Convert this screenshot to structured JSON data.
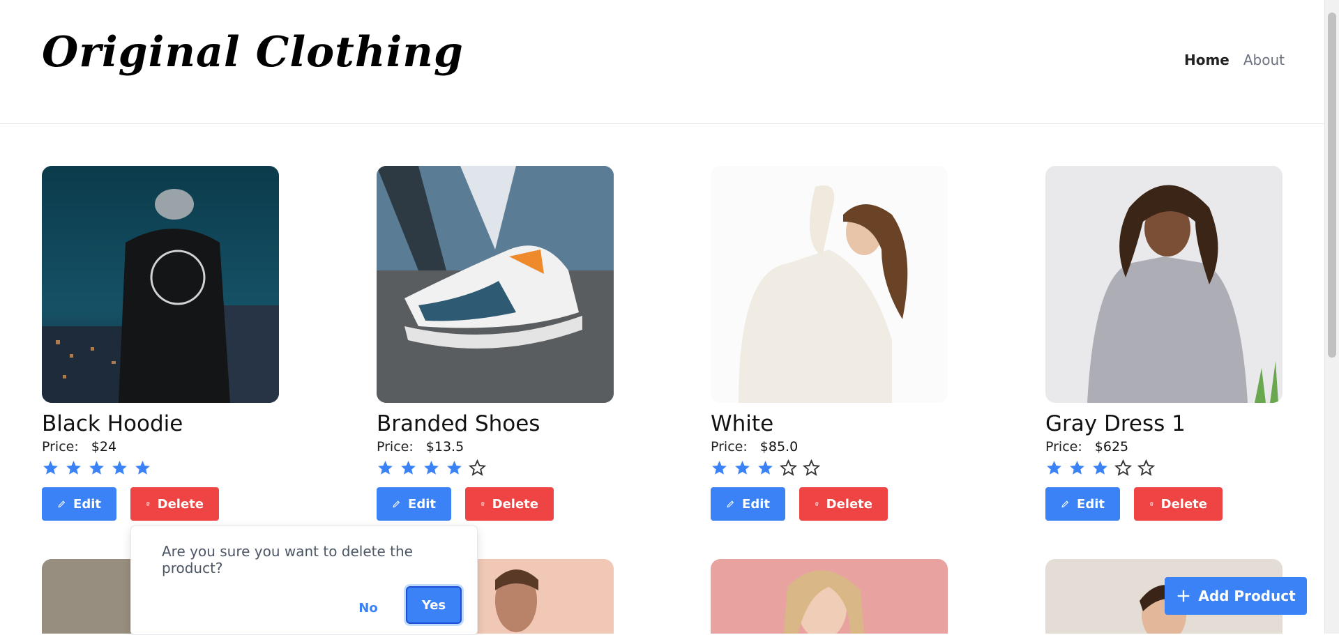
{
  "header": {
    "brand": "Original Clothing",
    "nav": [
      {
        "label": "Home",
        "active": true
      },
      {
        "label": "About",
        "active": false
      }
    ]
  },
  "products": [
    {
      "name": "Black Hoodie",
      "price_label": "Price:",
      "price": "$24",
      "rating": 5,
      "max_rating": 5,
      "edit_label": "Edit",
      "delete_label": "Delete"
    },
    {
      "name": "Branded Shoes",
      "price_label": "Price:",
      "price": "$13.5",
      "rating": 4,
      "max_rating": 5,
      "edit_label": "Edit",
      "delete_label": "Delete"
    },
    {
      "name": "White",
      "price_label": "Price:",
      "price": "$85.0",
      "rating": 3,
      "max_rating": 5,
      "edit_label": "Edit",
      "delete_label": "Delete"
    },
    {
      "name": "Gray Dress 1",
      "price_label": "Price:",
      "price": "$625",
      "rating": 3,
      "max_rating": 5,
      "edit_label": "Edit",
      "delete_label": "Delete"
    }
  ],
  "confirm_dialog": {
    "message": "Are you sure you want to delete the product?",
    "no_label": "No",
    "yes_label": "Yes"
  },
  "add_product_label": "Add Product",
  "colors": {
    "primary": "#3b82f6",
    "danger": "#ef4444",
    "star": "#3b82f6"
  }
}
